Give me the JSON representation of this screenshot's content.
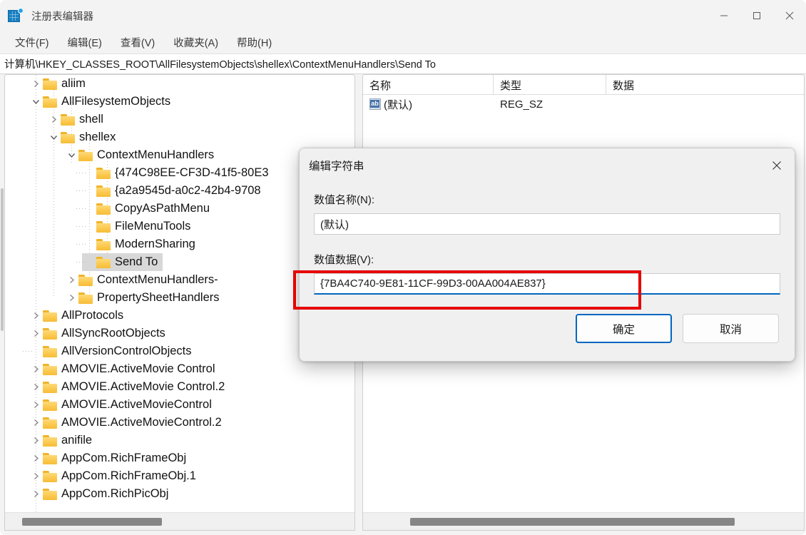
{
  "window": {
    "title": "注册表编辑器",
    "icon": "registry-editor-icon",
    "minimize_label": "最小化",
    "maximize_label": "最大化",
    "close_label": "关闭"
  },
  "menubar": {
    "items": [
      {
        "label": "文件(F)"
      },
      {
        "label": "编辑(E)"
      },
      {
        "label": "查看(V)"
      },
      {
        "label": "收藏夹(A)"
      },
      {
        "label": "帮助(H)"
      }
    ]
  },
  "addressbar": {
    "path": "计算机\\HKEY_CLASSES_ROOT\\AllFilesystemObjects\\shellex\\ContextMenuHandlers\\Send To"
  },
  "tree": {
    "rows": [
      {
        "label": "aliim",
        "depth": 1,
        "twisty": "collapsed",
        "selected": false
      },
      {
        "label": "AllFilesystemObjects",
        "depth": 1,
        "twisty": "expanded",
        "selected": false
      },
      {
        "label": "shell",
        "depth": 2,
        "twisty": "collapsed",
        "selected": false
      },
      {
        "label": "shellex",
        "depth": 2,
        "twisty": "expanded",
        "selected": false
      },
      {
        "label": "ContextMenuHandlers",
        "depth": 3,
        "twisty": "expanded",
        "selected": false
      },
      {
        "label": "{474C98EE-CF3D-41f5-80E3",
        "depth": 4,
        "twisty": "none",
        "selected": false
      },
      {
        "label": "{a2a9545d-a0c2-42b4-9708",
        "depth": 4,
        "twisty": "none",
        "selected": false
      },
      {
        "label": "CopyAsPathMenu",
        "depth": 4,
        "twisty": "none",
        "selected": false
      },
      {
        "label": "FileMenuTools",
        "depth": 4,
        "twisty": "none",
        "selected": false
      },
      {
        "label": "ModernSharing",
        "depth": 4,
        "twisty": "none",
        "selected": false
      },
      {
        "label": "Send To",
        "depth": 4,
        "twisty": "none",
        "selected": true
      },
      {
        "label": "ContextMenuHandlers-",
        "depth": 3,
        "twisty": "collapsed",
        "selected": false
      },
      {
        "label": "PropertySheetHandlers",
        "depth": 3,
        "twisty": "collapsed",
        "selected": false
      },
      {
        "label": "AllProtocols",
        "depth": 1,
        "twisty": "collapsed",
        "selected": false
      },
      {
        "label": "AllSyncRootObjects",
        "depth": 1,
        "twisty": "collapsed",
        "selected": false
      },
      {
        "label": "AllVersionControlObjects",
        "depth": 1,
        "twisty": "none",
        "selected": false
      },
      {
        "label": "AMOVIE.ActiveMovie Control",
        "depth": 1,
        "twisty": "collapsed",
        "selected": false
      },
      {
        "label": "AMOVIE.ActiveMovie Control.2",
        "depth": 1,
        "twisty": "collapsed",
        "selected": false
      },
      {
        "label": "AMOVIE.ActiveMovieControl",
        "depth": 1,
        "twisty": "collapsed",
        "selected": false
      },
      {
        "label": "AMOVIE.ActiveMovieControl.2",
        "depth": 1,
        "twisty": "collapsed",
        "selected": false
      },
      {
        "label": "anifile",
        "depth": 1,
        "twisty": "collapsed",
        "selected": false
      },
      {
        "label": "AppCom.RichFrameObj",
        "depth": 1,
        "twisty": "collapsed",
        "selected": false
      },
      {
        "label": "AppCom.RichFrameObj.1",
        "depth": 1,
        "twisty": "collapsed",
        "selected": false
      },
      {
        "label": "AppCom.RichPicObj",
        "depth": 1,
        "twisty": "collapsed",
        "selected": false
      }
    ]
  },
  "list": {
    "columns": [
      {
        "label": "名称"
      },
      {
        "label": "类型"
      },
      {
        "label": "数据"
      }
    ],
    "rows": [
      {
        "name": "(默认)",
        "type": "REG_SZ",
        "data": "",
        "icon": "string-value-icon"
      }
    ]
  },
  "dialog": {
    "title": "编辑字符串",
    "close_label": "关闭",
    "value_name_label": "数值名称(N):",
    "value_name": "(默认)",
    "value_data_label": "数值数据(V):",
    "value_data": "{7BA4C740-9E81-11CF-99D3-00AA004AE837}",
    "ok_label": "确定",
    "cancel_label": "取消"
  },
  "annotation": {
    "color": "#e60000",
    "target": "value-data-input"
  }
}
